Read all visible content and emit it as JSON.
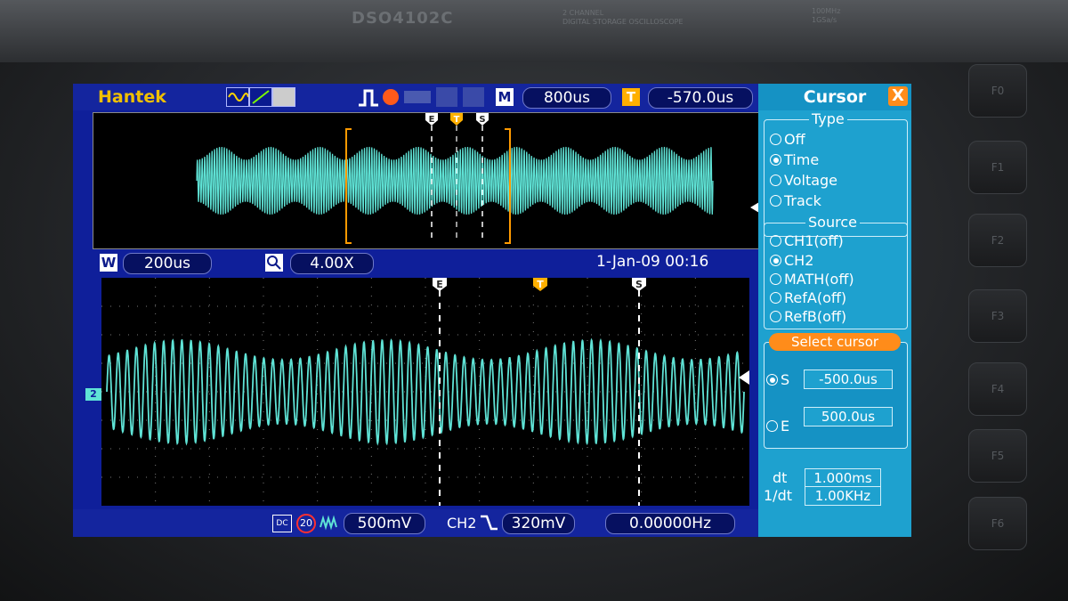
{
  "device": {
    "model": "DSO4102C",
    "description_line1": "2 CHANNEL",
    "description_line2": "DIGITAL STORAGE OSCILLOSCOPE",
    "spec_line1": "100MHz",
    "spec_line2": "1GSa/s",
    "fkeys": [
      "F0",
      "F1",
      "F2",
      "F3",
      "F4",
      "F5",
      "F6"
    ]
  },
  "header": {
    "brand": "Hantek",
    "mode_tag": "M",
    "timebase": "800us",
    "trigger_tag": "T",
    "trigger_offset": "-570.0us"
  },
  "overview": {
    "markers": [
      "E",
      "T",
      "S"
    ]
  },
  "zoom_bar": {
    "window_tag": "W",
    "window_value": "200us",
    "zoom_factor": "4.00X",
    "datetime": "1-Jan-09 00:16"
  },
  "main": {
    "markers": [
      "E",
      "T",
      "S"
    ],
    "channel_marker": "2"
  },
  "status": {
    "coupling": "DC",
    "bandwidth_limit": "20",
    "volts_per_div": "500mV",
    "trigger_source": "CH2",
    "trigger_level": "320mV",
    "frequency": "0.00000Hz"
  },
  "panel": {
    "title": "Cursor",
    "close": "X",
    "type_title": "Type",
    "type_options": [
      {
        "label": "Off",
        "selected": false
      },
      {
        "label": "Time",
        "selected": true
      },
      {
        "label": "Voltage",
        "selected": false
      },
      {
        "label": "Track",
        "selected": false
      }
    ],
    "source_title": "Source",
    "source_options": [
      {
        "label": "CH1(off)",
        "selected": false
      },
      {
        "label": "CH2",
        "selected": true
      },
      {
        "label": "MATH(off)",
        "selected": false
      },
      {
        "label": "RefA(off)",
        "selected": false
      },
      {
        "label": "RefB(off)",
        "selected": false
      }
    ],
    "select_title": "Select cursor",
    "s_label": "S",
    "s_value": "-500.0us",
    "e_label": "E",
    "e_value": "500.0us",
    "dt_label": "dt",
    "dt_value": "1.000ms",
    "inv_dt_label": "1/dt",
    "inv_dt_value": "1.00KHz"
  },
  "colors": {
    "trace": "#5fe3d6",
    "screen_bg": "#0f1f9a",
    "panel_bg": "#1ea1cf",
    "accent_orange": "#ff8c1a",
    "brand_yellow": "#f0c000"
  },
  "signal": {
    "carrier_cycles_main": 70,
    "envelope_cycles_main": 3.1,
    "carrier_cycles_overview": 210,
    "envelope_cycles_overview": 10.5,
    "modulation_depth": 0.38
  }
}
